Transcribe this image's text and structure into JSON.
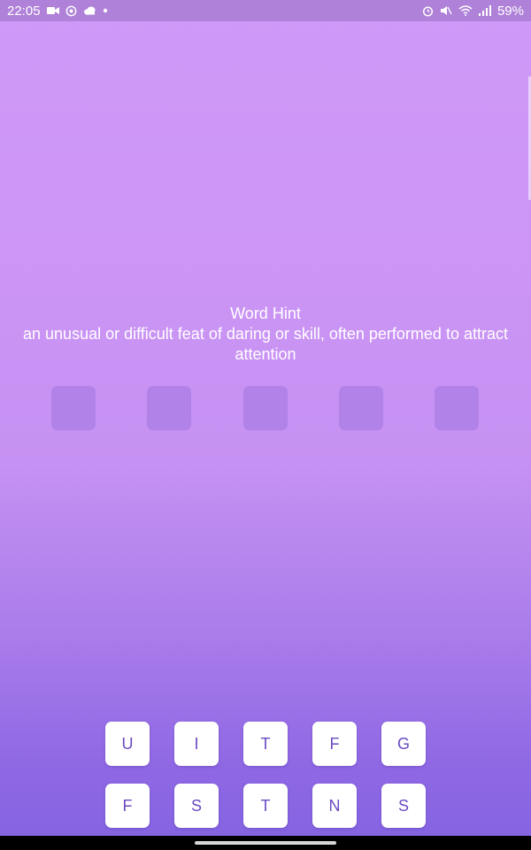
{
  "status_bar": {
    "time": "22:05",
    "battery": "59%",
    "left_icons": [
      "video-icon",
      "whatsapp-icon",
      "cloud-icon",
      "dot-icon"
    ],
    "right_icons": [
      "alarm-icon",
      "mute-icon",
      "wifi-icon",
      "signal-icon"
    ]
  },
  "hint": {
    "title": "Word Hint",
    "text": "an unusual or difficult feat of daring or skill, often performed to attract attention"
  },
  "answer": {
    "slots": [
      "",
      "",
      "",
      "",
      ""
    ]
  },
  "letters": {
    "row1": [
      "U",
      "I",
      "T",
      "F",
      "G"
    ],
    "row2": [
      "F",
      "S",
      "T",
      "N",
      "S"
    ]
  },
  "colors": {
    "accent": "#6a4ac2",
    "gradient_top": "#cf99f8",
    "gradient_bottom": "#8463e2"
  }
}
